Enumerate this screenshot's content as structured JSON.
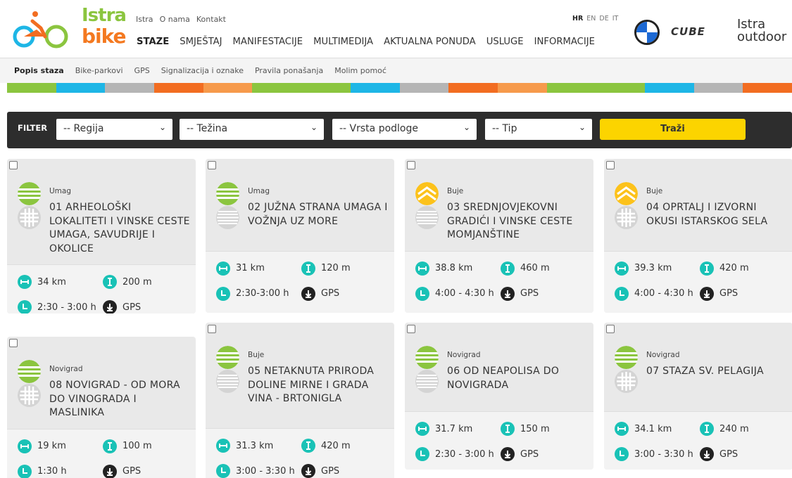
{
  "header": {
    "logo_istra": "Istra",
    "logo_bike": "bike",
    "topnav": [
      "Istra",
      "O nama",
      "Kontakt"
    ],
    "mainnav": [
      "STAZE",
      "SMJEŠTAJ",
      "MANIFESTACIJE",
      "MULTIMEDIJA",
      "AKTUALNA PONUDA",
      "USLUGE",
      "INFORMACIJE"
    ],
    "langs": [
      "HR",
      "EN",
      "DE",
      "IT"
    ],
    "sponsor_cube": "CUBE",
    "sponsor_istra_line1": "Istra",
    "sponsor_istra_line2": "outdoor"
  },
  "subnav": [
    "Popis staza",
    "Bike-parkovi",
    "GPS",
    "Signalizacija i oznake",
    "Pravila ponašanja",
    "Molim pomoć"
  ],
  "stripe_colors": [
    "#8bc53f",
    "#1eb6e6",
    "#b5b5b5",
    "#f26d21",
    "#f69a4b",
    "#8bc53f",
    "#8bc53f",
    "#1eb6e6",
    "#b5b5b5",
    "#f26d21",
    "#f69a4b",
    "#8bc53f",
    "#8bc53f",
    "#1eb6e6",
    "#b5b5b5",
    "#f26d21"
  ],
  "filter": {
    "label": "FILTER",
    "regija": "-- Regija",
    "tezina": "-- Težina",
    "podloga": "-- Vrsta podloge",
    "tip": "-- Tip",
    "button": "Traži"
  },
  "cards": [
    {
      "region": "Umag",
      "title": "01  ARHEOLOŠKI LOKALITETI I VINSKE CESTE UMAGA, SAVUDRIJE I OKOLICE",
      "km": "34 km",
      "elev": "200 m",
      "time": "2:30 - 3:00 h",
      "gps": "GPS",
      "difficulty": "green",
      "surface": "grid"
    },
    {
      "region": "Umag",
      "title": "02  JUŽNA STRANA UMAGA I VOŽNJA UZ MORE",
      "km": "31 km",
      "elev": "120 m",
      "time": "2:30-3:00 h",
      "gps": "GPS",
      "difficulty": "green",
      "surface": "lines"
    },
    {
      "region": "Buje",
      "title": "03  SREDNJOVJEKOVNI GRADIĆI I VINSKE CESTE MOMJANŠTINE",
      "km": "38.8 km",
      "elev": "460 m",
      "time": "4:00 - 4:30 h",
      "gps": "GPS",
      "difficulty": "yellow",
      "surface": "lines"
    },
    {
      "region": "Buje",
      "title": "04  OPRTALJ I IZVORNI OKUSI ISTARSKOG SELA",
      "km": "39.3 km",
      "elev": "420 m",
      "time": "4:00 - 4:30 h",
      "gps": "GPS",
      "difficulty": "yellow",
      "surface": "grid"
    },
    {
      "region": "Novigrad",
      "title": "08  NOVIGRAD - OD MORA DO VINOGRADA I MASLINIKA",
      "km": "19 km",
      "elev": "100 m",
      "time": "1:30 h",
      "gps": "GPS",
      "difficulty": "green",
      "surface": "grid"
    },
    {
      "region": "Buje",
      "title": "05  NETAKNUTA PRIRODA DOLINE MIRNE I GRADA VINA - BRTONIGLA",
      "km": "31.3 km",
      "elev": "420 m",
      "time": "3:00 - 3:30 h",
      "gps": "GPS",
      "difficulty": "green",
      "surface": "lines"
    },
    {
      "region": "Novigrad",
      "title": "06  OD NEAPOLISA DO NOVIGRADA",
      "km": "31.7 km",
      "elev": "150 m",
      "time": "2:30 - 3:00 h",
      "gps": "GPS",
      "difficulty": "green",
      "surface": "lines"
    },
    {
      "region": "Novigrad",
      "title": "07  STAZA SV. PELAGIJA",
      "km": "34.1 km",
      "elev": "240 m",
      "time": "3:00 - 3:30 h",
      "gps": "GPS",
      "difficulty": "green",
      "surface": "grid"
    }
  ],
  "colors": {
    "teal": "#19c2b6",
    "green_difficulty": "#8bc53f",
    "yellow_difficulty": "#fcc21b",
    "search_button": "#fcd400",
    "filter_bar": "#2d2d2d"
  }
}
